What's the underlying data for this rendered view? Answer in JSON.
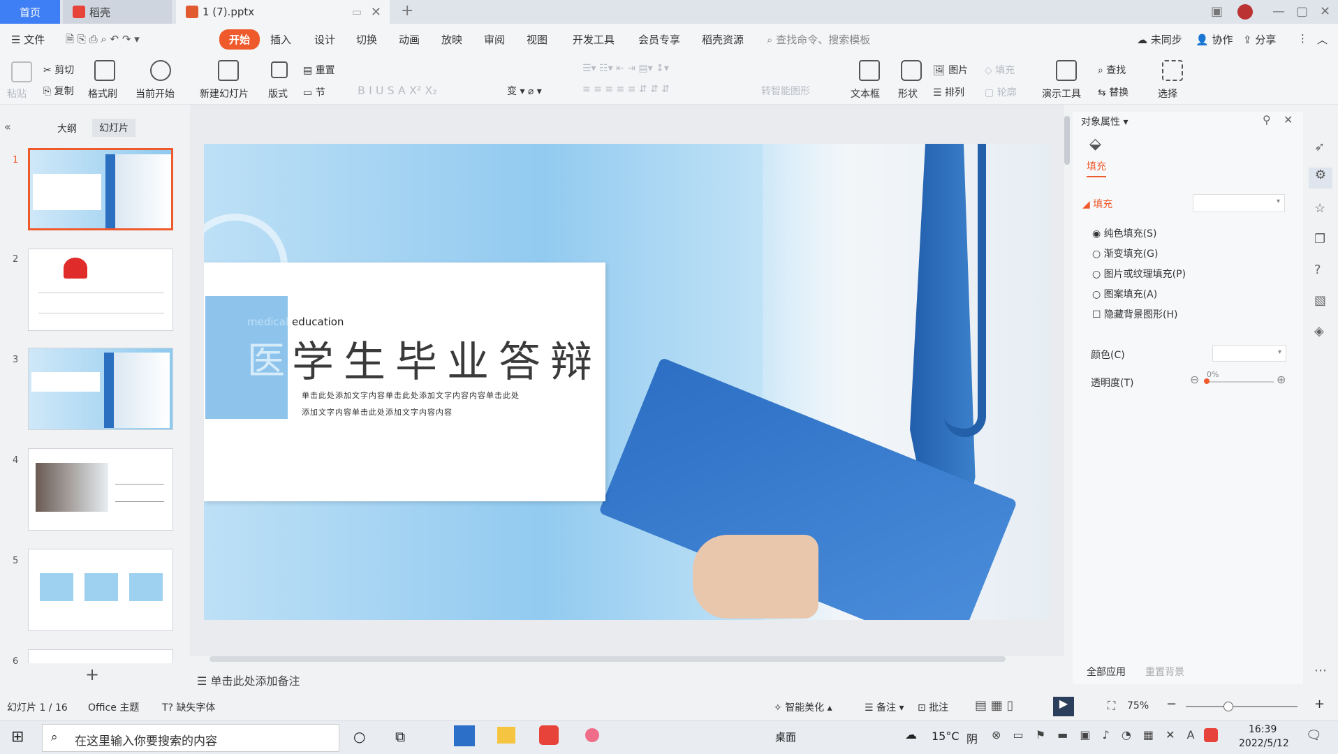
{
  "tabs": {
    "home": "首页",
    "daoke": "稻壳",
    "file": "1 (7).pptx"
  },
  "menu": {
    "file": "文件",
    "start": "开始",
    "insert": "插入",
    "design": "设计",
    "transition": "切换",
    "animation": "动画",
    "show": "放映",
    "review": "审阅",
    "view": "视图",
    "dev": "开发工具",
    "member": "会员专享",
    "resource": "稻壳资源",
    "search": "查找命令、搜索模板",
    "sync": "未同步",
    "collab": "协作",
    "share": "分享"
  },
  "ribbon": {
    "paste": "粘贴",
    "cut": "剪切",
    "copy": "复制",
    "format_painter": "格式刷",
    "from_current": "当前开始",
    "new_slide": "新建幻灯片",
    "layout": "版式",
    "reset": "重置",
    "section": "节",
    "text_convert": "转智能图形",
    "textbox": "文本框",
    "shape": "形状",
    "picture": "图片",
    "arrange": "排列",
    "fill": "填充",
    "outline": "轮廓",
    "present_tools": "演示工具",
    "find": "查找",
    "replace": "替换",
    "select": "选择"
  },
  "left": {
    "outline_tab": "大纲",
    "slides_tab": "幻灯片",
    "numbers": [
      "1",
      "2",
      "3",
      "4",
      "5",
      "6"
    ]
  },
  "slide": {
    "medical": "medical",
    "education": "education",
    "hospital_char": "医",
    "title": "学生毕业答辩",
    "desc1": "单击此处添加文字内容单击此处添加文字内容内容单击此处",
    "desc2": "添加文字内容单击此处添加文字内容内容"
  },
  "notes": "单击此处添加备注",
  "right": {
    "header": "对象属性",
    "fill_tab": "填充",
    "fill_section": "填充",
    "opt_solid": "纯色填充(S)",
    "opt_gradient": "渐变填充(G)",
    "opt_picture": "图片或纹理填充(P)",
    "opt_pattern": "图案填充(A)",
    "opt_hide_bg": "隐藏背景图形(H)",
    "color": "颜色(C)",
    "transparency": "透明度(T)",
    "transparency_value": "0%",
    "apply_all": "全部应用",
    "reset_bg": "重置背景"
  },
  "status": {
    "slide_count": "幻灯片 1 / 16",
    "theme": "Office 主题",
    "missing_font": "缺失字体",
    "beautify": "智能美化",
    "notes": "备注",
    "comment": "批注",
    "zoom": "75%"
  },
  "taskbar": {
    "search": "在这里输入你要搜索的内容",
    "desktop": "桌面",
    "temp": "15°C",
    "weather": "阴",
    "time": "16:39",
    "date": "2022/5/12"
  },
  "colors": {
    "accent": "#ef5a2c",
    "tab_blue": "#3f7ff5",
    "slide_blue": "#8ec4ec"
  }
}
